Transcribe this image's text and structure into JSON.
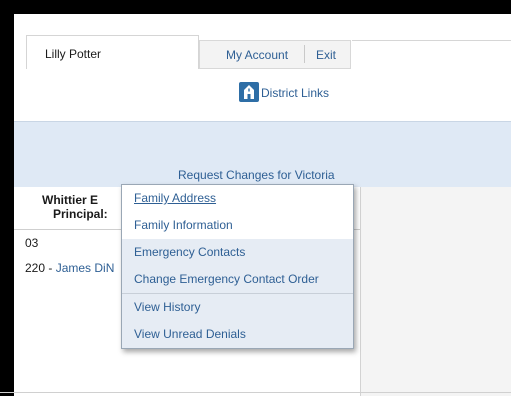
{
  "header": {
    "user_name": "Lilly Potter",
    "my_account_label": "My Account",
    "exit_label": "Exit",
    "district_links_label": "District Links",
    "district_icon": "school-building-icon"
  },
  "request": {
    "label": "Request Changes for Victoria"
  },
  "school": {
    "name_partial": "Whittier E",
    "principal_label": "Principal:",
    "grade": "03",
    "homeroom_number": "220 - ",
    "homeroom_teacher_partial": "James DiN"
  },
  "menu": {
    "items": [
      {
        "label": "Family Address"
      },
      {
        "label": "Family Information"
      },
      {
        "label": "Emergency Contacts"
      },
      {
        "label": "Change Emergency Contact Order"
      },
      {
        "label": "View History"
      },
      {
        "label": "View Unread Denials"
      }
    ]
  },
  "colors": {
    "link": "#2e5f94",
    "band": "#dfe9f5",
    "icon_bg": "#2e6ea6"
  }
}
